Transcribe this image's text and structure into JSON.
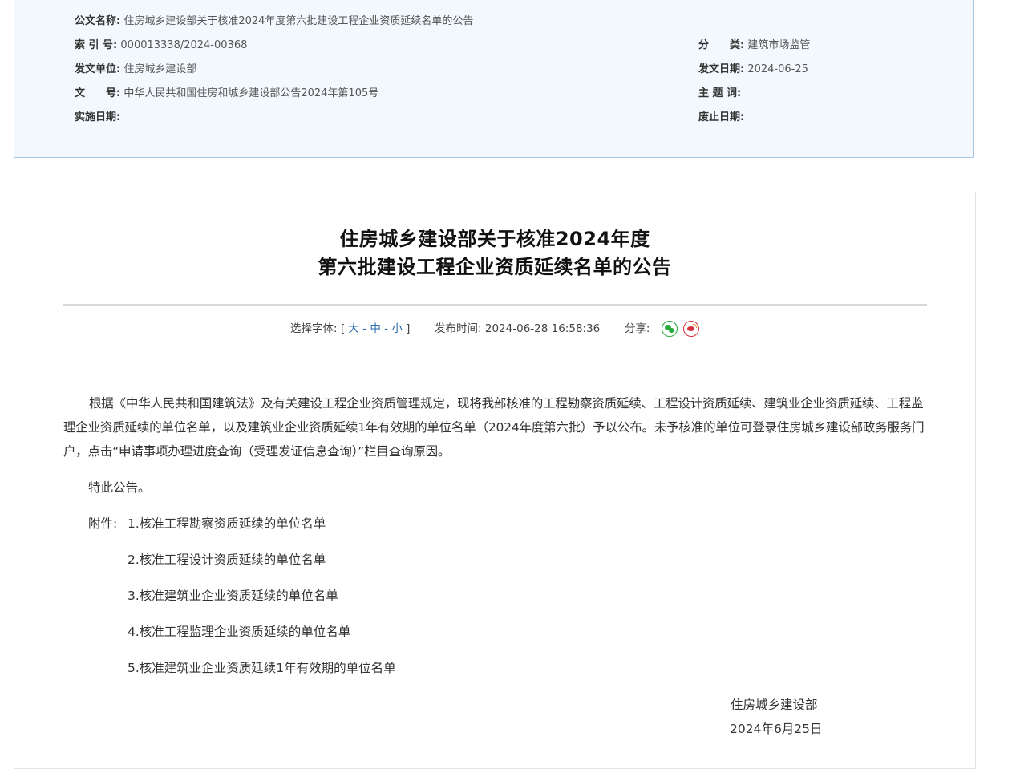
{
  "meta": {
    "doc_name_label": "公文名称:",
    "doc_name": "住房城乡建设部关于核准2024年度第六批建设工程企业资质延续名单的公告",
    "index_label": "索 引 号:",
    "index": "000013338/2024-00368",
    "category_label": "分　　类:",
    "category": "建筑市场监管",
    "issuer_label": "发文单位:",
    "issuer": "住房城乡建设部",
    "issue_date_label": "发文日期:",
    "issue_date": "2024-06-25",
    "doc_no_label": "文　　号:",
    "doc_no": "中华人民共和国住房和城乡建设部公告2024年第105号",
    "keywords_label": "主 题 词:",
    "keywords": "",
    "effective_date_label": "实施日期:",
    "effective_date": "",
    "expiry_date_label": "废止日期:",
    "expiry_date": ""
  },
  "article": {
    "title_line1": "住房城乡建设部关于核准2024年度",
    "title_line2": "第六批建设工程企业资质延续名单的公告",
    "font_label": "选择字体:",
    "bracket_open": "[",
    "bracket_close": "]",
    "size_large": "大",
    "size_medium": "中",
    "size_small": "小",
    "sep": "-",
    "publish_label": "发布时间:",
    "publish_time": "2024-06-28 16:58:36",
    "share_label": "分享:",
    "paragraph": "根据《中华人民共和国建筑法》及有关建设工程企业资质管理规定，现将我部核准的工程勘察资质延续、工程设计资质延续、建筑业企业资质延续、工程监理企业资质延续的单位名单，以及建筑业企业资质延续1年有效期的单位名单（2024年度第六批）予以公布。未予核准的单位可登录住房城乡建设部政务服务门户，点击“申请事项办理进度查询（受理发证信息查询）”栏目查询原因。",
    "closing": "特此公告。",
    "attachment_label": "附件:",
    "attachments": [
      "1.核准工程勘察资质延续的单位名单",
      "2.核准工程设计资质延续的单位名单",
      "3.核准建筑业企业资质延续的单位名单",
      "4.核准工程监理企业资质延续的单位名单",
      "5.核准建筑业企业资质延续1年有效期的单位名单"
    ],
    "signature": "住房城乡建设部",
    "sign_date": "2024年6月25日"
  },
  "colors": {
    "meta_bg": "#f2f8fd",
    "meta_border": "#a9c6e0",
    "link": "#2b6cb0",
    "wechat": "#2aaa3f",
    "weibo": "#d6323c"
  },
  "icons": [
    "wechat-icon",
    "weibo-icon"
  ]
}
